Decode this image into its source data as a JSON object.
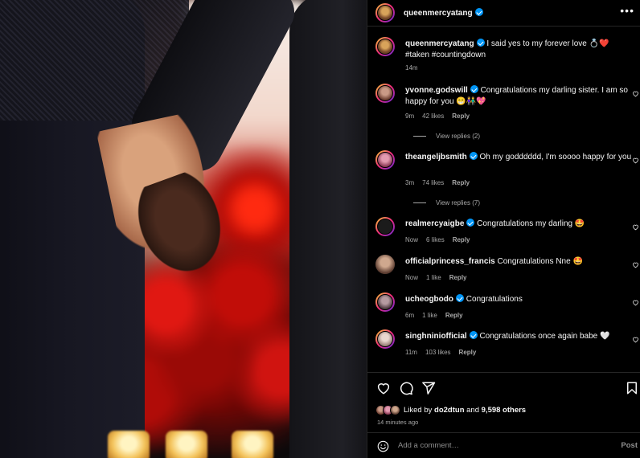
{
  "post": {
    "username": "queenmercyatang",
    "more_label": "•••"
  },
  "caption": {
    "username": "queenmercyatang",
    "text": "I said yes to my forever love 💍❤️ #taken #countingdown",
    "time": "14m"
  },
  "comments": [
    {
      "username": "yvonne.godswill",
      "verified": true,
      "text": "Congratulations my darling sister. I am so happy for you 😁👫💖",
      "time": "9m",
      "likes": "42 likes",
      "reply": "Reply",
      "view_replies": "View replies (2)"
    },
    {
      "username": "theangeljbsmith",
      "verified": true,
      "text": "Oh my godddddd, I'm soooo happy for you",
      "time": "3m",
      "likes": "74 likes",
      "reply": "Reply",
      "view_replies": "View replies (7)"
    },
    {
      "username": "realmercyaigbe",
      "verified": true,
      "text": "Congratulations my darling 🤩",
      "time": "Now",
      "likes": "6 likes",
      "reply": "Reply"
    },
    {
      "username": "officialprincess_francis",
      "verified": false,
      "text": "Congratulations Nne 🤩",
      "time": "Now",
      "likes": "1 like",
      "reply": "Reply"
    },
    {
      "username": "ucheogbodo",
      "verified": true,
      "text": "Congratulations",
      "time": "6m",
      "likes": "1 like",
      "reply": "Reply"
    },
    {
      "username": "singhniniofficial",
      "verified": true,
      "text": "Congratulations once again babe 🤍",
      "time": "11m",
      "likes": "103 likes",
      "reply": "Reply"
    }
  ],
  "likes": {
    "prefix": "Liked by",
    "user": "do2dtun",
    "and": "and",
    "others": "9,598 others"
  },
  "posted_ago": "14 minutes ago",
  "composer": {
    "placeholder": "Add a comment…",
    "post_label": "Post"
  },
  "icons": [
    "more-icon",
    "heart-icon",
    "comment-icon",
    "share-icon",
    "bookmark-icon",
    "emoji-icon",
    "verified-icon"
  ],
  "colors": {
    "verified": "#0095f6",
    "background": "#000000",
    "muted_text": "#a8a8a8"
  }
}
